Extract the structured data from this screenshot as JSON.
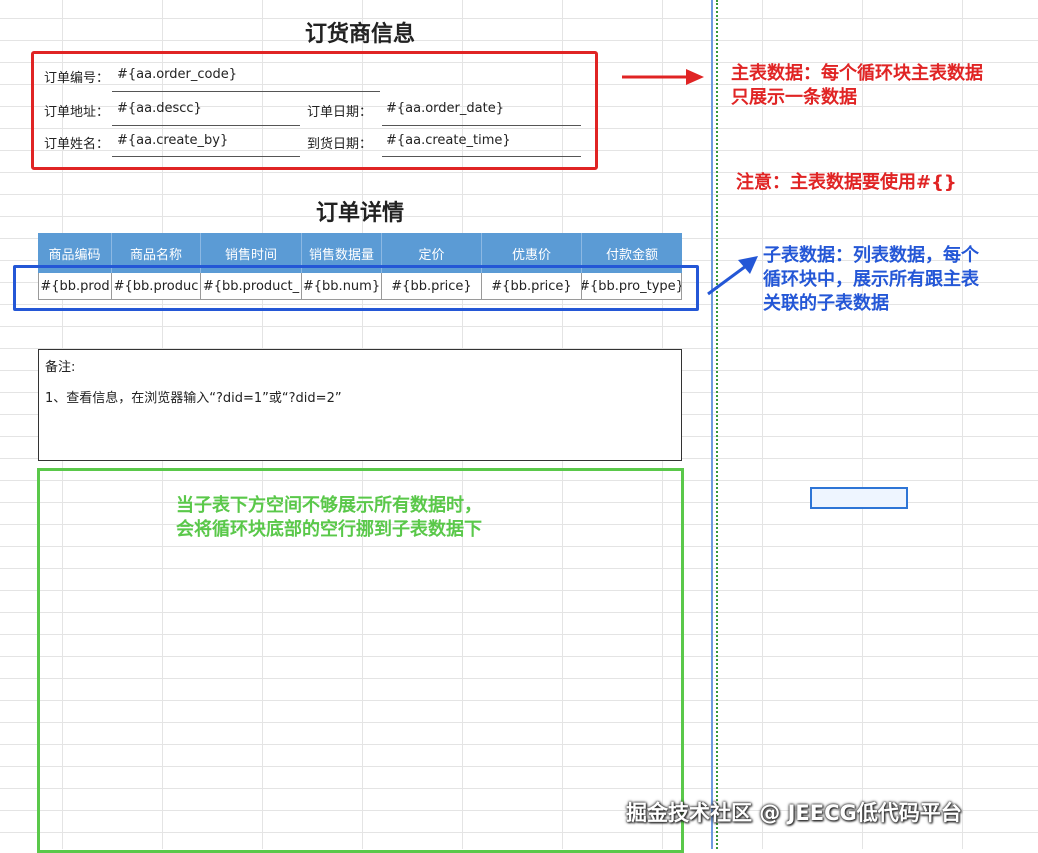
{
  "order_info": {
    "title": "订货商信息",
    "fields": [
      {
        "label": "订单编号：",
        "value": "#{aa.order_code}"
      },
      {
        "label": "订单地址：",
        "value": "#{aa.descc}"
      },
      {
        "label": "订单日期：",
        "value": "#{aa.order_date}"
      },
      {
        "label": "订单姓名：",
        "value": "#{aa.create_by}"
      },
      {
        "label": "到货日期：",
        "value": "#{aa.create_time}"
      }
    ]
  },
  "order_detail": {
    "title": "订单详情",
    "columns": [
      "商品编码",
      "商品名称",
      "销售时间",
      "销售数据量",
      "定价",
      "优惠价",
      "付款金额"
    ],
    "row": [
      "#{bb.prod",
      "#{bb.produc",
      "#{bb.product_",
      "#{bb.num}",
      "#{bb.price}",
      "#{bb.price}",
      "#{bb.pro_type}"
    ]
  },
  "notes": {
    "heading": "备注:",
    "line1": "1、查看信息，在浏览器输入“?did=1”或“?did=2”"
  },
  "annotations": {
    "main_table": [
      "主表数据：每个循环块主表数据",
      "只展示一条数据"
    ],
    "note": "注意：主表数据要使用#{}",
    "sub_table": [
      "子表数据：列表数据，每个",
      "循环块中，展示所有跟主表",
      "关联的子表数据"
    ],
    "overflow": [
      "当子表下方空间不够展示所有数据时，",
      "会将循环块底部的空行挪到子表数据下"
    ]
  },
  "watermark": "掘金技术社区 @ JEECG低代码平台",
  "colors": {
    "red": "#e02424",
    "blue": "#2457d6",
    "green": "#5ac84a",
    "header_blue": "#5b9bd5"
  }
}
